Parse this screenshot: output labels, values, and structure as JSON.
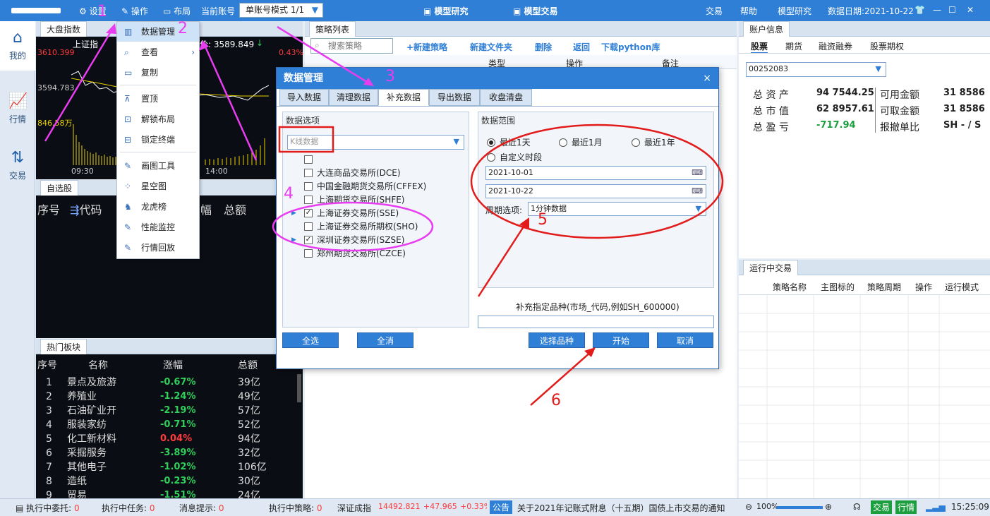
{
  "topbar": {
    "settings": "设置",
    "operation": "操作",
    "layout": "布局",
    "account_label": "当前账号",
    "account_mode": "单账号模式 1/1",
    "center_tabs": [
      "模型研究",
      "模型交易"
    ],
    "right_menu": [
      "交易",
      "帮助",
      "模型研究"
    ],
    "date_label": "数据日期:2021-10-22"
  },
  "leftnav": [
    {
      "label": "我的",
      "icon": "home-icon"
    },
    {
      "label": "行情",
      "icon": "chart-icon"
    },
    {
      "label": "交易",
      "icon": "trade-icon"
    }
  ],
  "index_panel": {
    "tab": "大盘指数",
    "name": "上证指",
    "price_label": "价: 3589.849",
    "arrow": "↓",
    "high": "3610.399",
    "mid": "3594.783",
    "vol": "846.58万",
    "pct_top": "0.43%",
    "times": [
      "09:30",
      "14:00"
    ]
  },
  "watchlist": {
    "tab": "自选股",
    "headers": [
      "序号",
      "代码",
      "幅",
      "总额"
    ]
  },
  "hot_sectors": {
    "tab": "热门板块",
    "headers": [
      "序号",
      "名称",
      "涨幅",
      "总额"
    ],
    "rows": [
      {
        "no": "1",
        "name": "景点及旅游",
        "chg": "-0.67%",
        "amt": "39亿"
      },
      {
        "no": "2",
        "name": "养殖业",
        "chg": "-1.24%",
        "amt": "49亿"
      },
      {
        "no": "3",
        "name": "石油矿业开",
        "chg": "-2.19%",
        "amt": "57亿"
      },
      {
        "no": "4",
        "name": "服装家纺",
        "chg": "-0.71%",
        "amt": "52亿"
      },
      {
        "no": "5",
        "name": "化工新材料",
        "chg": "0.04%",
        "amt": "94亿"
      },
      {
        "no": "6",
        "name": "采掘服务",
        "chg": "-3.89%",
        "amt": "32亿"
      },
      {
        "no": "7",
        "name": "其他电子",
        "chg": "-1.02%",
        "amt": "106亿"
      },
      {
        "no": "8",
        "name": "造纸",
        "chg": "-0.23%",
        "amt": "30亿"
      },
      {
        "no": "9",
        "name": "贸易",
        "chg": "-1.51%",
        "amt": "24亿"
      }
    ]
  },
  "context_menu": {
    "items": [
      "数据管理",
      "查看",
      "复制",
      "置顶",
      "解锁布局",
      "锁定终端",
      "画图工具",
      "星空图",
      "龙虎榜",
      "性能监控",
      "行情回放"
    ]
  },
  "strategy": {
    "tab": "策略列表",
    "search_placeholder": "搜索策略",
    "actions": [
      "+新建策略",
      "新建文件夹",
      "删除",
      "返回",
      "下载python库"
    ],
    "headers": [
      "类型",
      "操作",
      "备注"
    ]
  },
  "dialog": {
    "title": "数据管理",
    "close": "×",
    "tabs": [
      "导入数据",
      "清理数据",
      "补充数据",
      "导出数据",
      "收盘清盘"
    ],
    "options_label": "数据选项",
    "dropdown_value": "K线数据",
    "exchanges": [
      {
        "name": "",
        "checked": false
      },
      {
        "name": "大连商品交易所(DCE)",
        "checked": false
      },
      {
        "name": "中国金融期货交易所(CFFEX)",
        "checked": false
      },
      {
        "name": "上海期货交易所(SHFE)",
        "checked": false
      },
      {
        "name": "上海证券交易所(SSE)",
        "checked": true
      },
      {
        "name": "上海证券交易所期权(SHO)",
        "checked": false
      },
      {
        "name": "深圳证券交易所(SZSE)",
        "checked": true
      },
      {
        "name": "郑州期货交易所(CZCE)",
        "checked": false
      }
    ],
    "range_label": "数据范围",
    "radios": [
      "最近1天",
      "最近1月",
      "最近1年",
      "自定义时段"
    ],
    "date_from": "2021-10-01",
    "date_to": "2021-10-22",
    "period_label": "周期选项:",
    "period_value": "1分钟数据",
    "supplement_label": "补充指定品种(市场_代码,例如SH_600000)",
    "buttons": {
      "select_all": "全选",
      "deselect_all": "全消",
      "choose": "选择品种",
      "start": "开始",
      "cancel": "取消"
    }
  },
  "account": {
    "tab": "账户信息",
    "subtabs": [
      "股票",
      "期货",
      "融资融券",
      "股票期权"
    ],
    "account_id": "00252083",
    "rows": [
      {
        "label": "总 资 产",
        "value": "94 7544.25",
        "label2": "可用金额",
        "value2": "31 8586"
      },
      {
        "label": "总 市 值",
        "value": "62 8957.61",
        "label2": "可取金额",
        "value2": "31 8586"
      },
      {
        "label": "总 盈 亏",
        "value": "-717.94",
        "label2": "报撤单比",
        "value2": "SH - / S"
      }
    ]
  },
  "running": {
    "tab": "运行中交易",
    "headers": [
      "策略名称",
      "主图标的",
      "策略周期",
      "操作",
      "运行模式"
    ]
  },
  "statusbar": {
    "entrust": "执行中委托:",
    "entrust_n": "0",
    "task": "执行中任务:",
    "task_n": "0",
    "msg": "消息提示:",
    "msg_n": "0",
    "strat": "执行中策略:",
    "strat_n": "0",
    "index_name": "深证成指",
    "index_val": "14492.821",
    "index_chg": "+47.965",
    "index_pct": "+0.33%",
    "notice_tag": "公告",
    "notice": "关于2021年记账式附息（十五期）国债上市交易的通知",
    "zoom": "100%",
    "trade_tag": "交易",
    "quote_tag": "行情",
    "time": "15:25:09"
  },
  "annotations": [
    "1",
    "2",
    "3",
    "4",
    "5",
    "6"
  ],
  "colors": {
    "accent": "#2f7fd6",
    "annotation_pink": "#e83cf0",
    "annotation_red": "#e21b1b",
    "up": "#ff3b3b",
    "down": "#2fcf5a"
  }
}
